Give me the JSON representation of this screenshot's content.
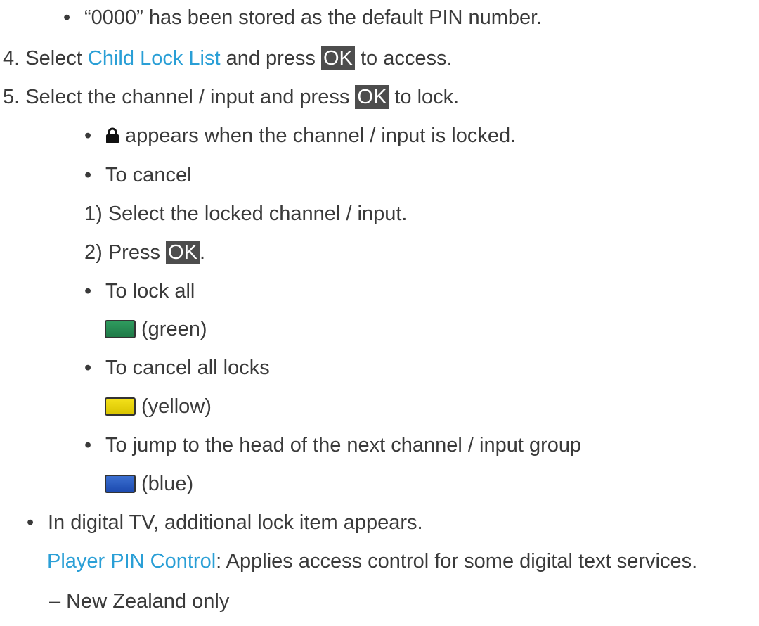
{
  "lines": {
    "default_pin": "“0000” has been stored as the default PIN number.",
    "step4_num": "4.",
    "step4_pre": "Select ",
    "step4_link": "Child Lock List",
    "step4_mid": " and press ",
    "step4_key": "OK",
    "step4_post": " to access.",
    "step5_num": "5.",
    "step5_pre": "Select the channel / input and press ",
    "step5_key": "OK",
    "step5_post": " to lock.",
    "lock_appears": "appears when the channel / input is locked.",
    "to_cancel": "To cancel",
    "cancel_1": "1)  Select the locked channel / input.",
    "cancel_2_pre": "2)  Press ",
    "cancel_2_key": "OK",
    "cancel_2_post": ".",
    "to_lock_all": "To lock all",
    "green_label": "(green)",
    "to_cancel_all": "To cancel all locks",
    "yellow_label": "(yellow)",
    "to_jump": "To jump to the head of the next channel / input group",
    "blue_label": "(blue)",
    "digital_tv": "In digital TV, additional lock item appears.",
    "player_pin_link": "Player PIN Control",
    "player_pin_desc": ": Applies access control for some digital text services.",
    "nz_only": "–  New Zealand only"
  },
  "bullet": "•",
  "colors": {
    "link": "#2a9fd6",
    "key_bg": "#4d4d4d",
    "green": "#2e9a5e",
    "yellow": "#f3e01a",
    "blue": "#3b6fd0"
  },
  "icons": {
    "lock": "lock-icon",
    "green_button": "green-button-icon",
    "yellow_button": "yellow-button-icon",
    "blue_button": "blue-button-icon"
  }
}
